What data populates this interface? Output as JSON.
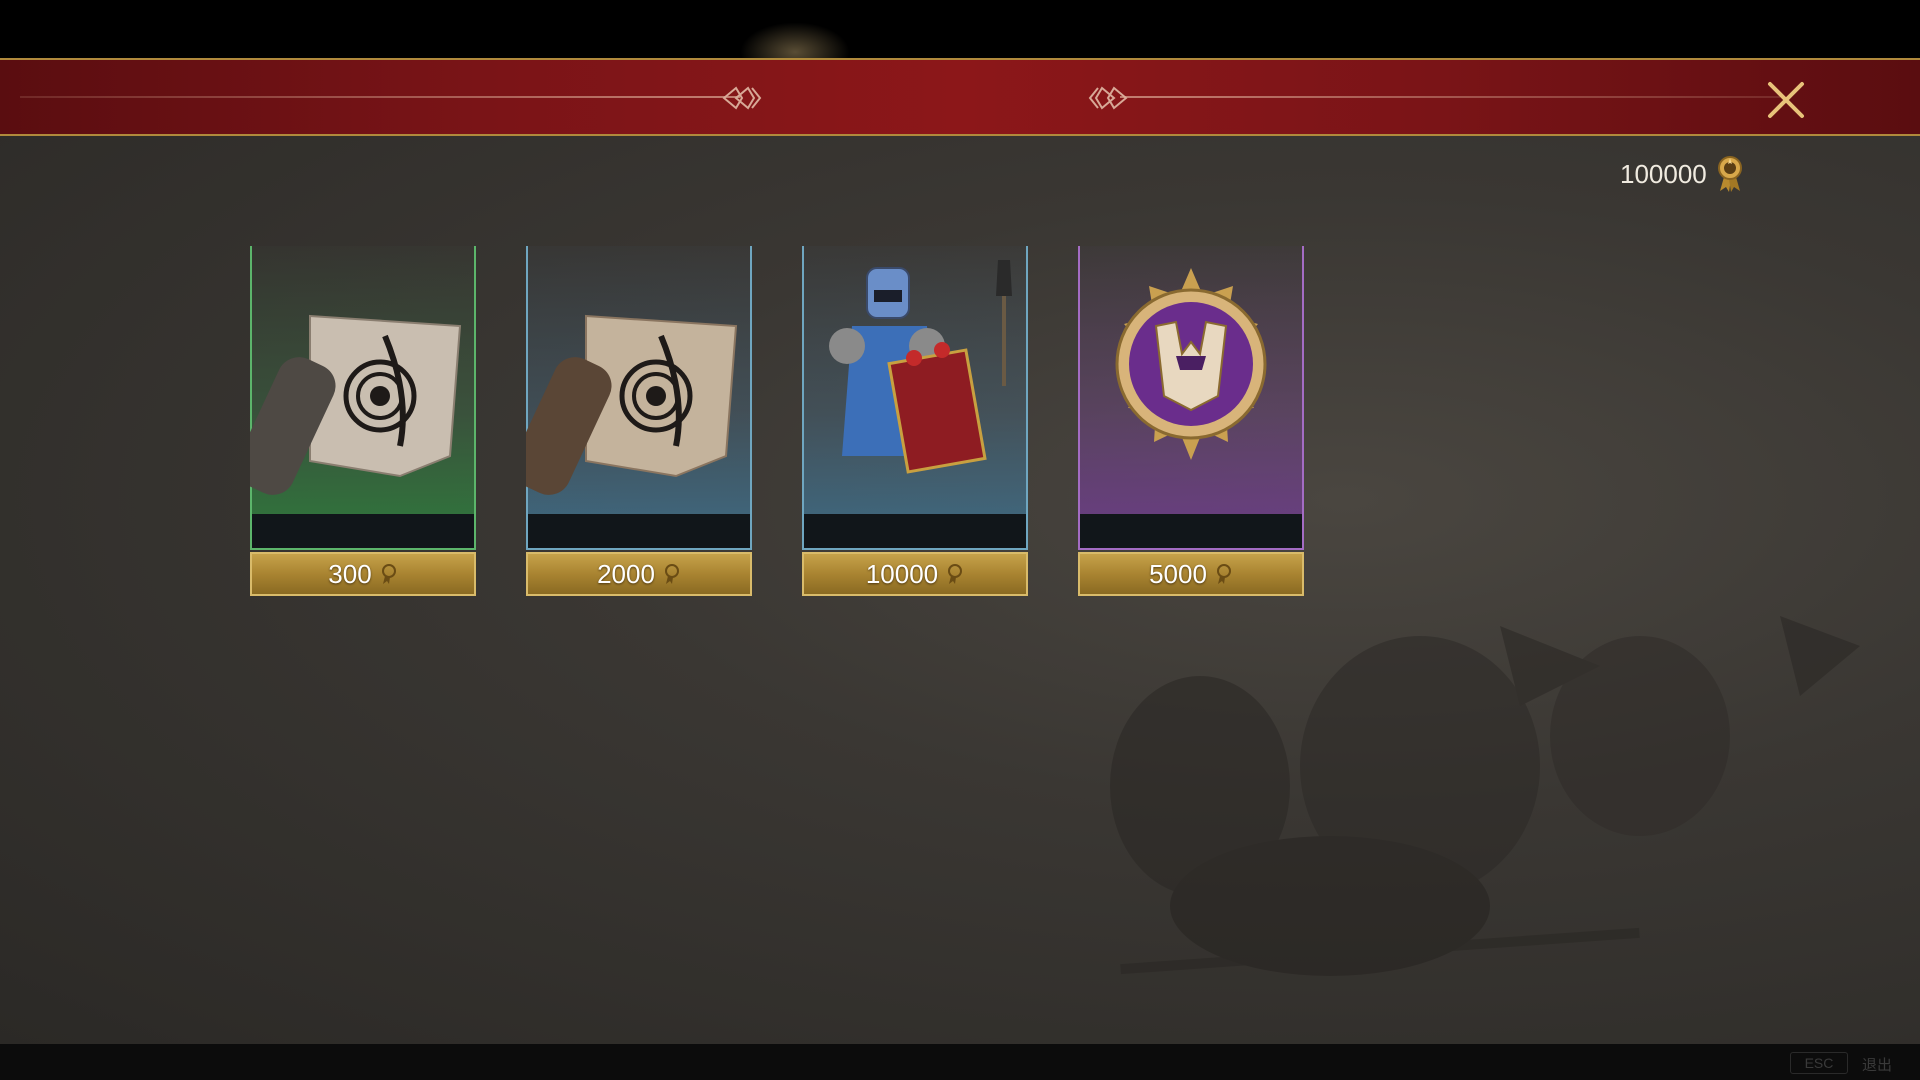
{
  "currency": {
    "amount": "100000",
    "icon": "medal-icon"
  },
  "shop": {
    "items": [
      {
        "price": "300",
        "rarity": "green",
        "icon": "scroll-icon",
        "name": ""
      },
      {
        "price": "2000",
        "rarity": "blue",
        "icon": "scroll-icon",
        "name": ""
      },
      {
        "price": "10000",
        "rarity": "blue",
        "icon": "knight-portrait-icon",
        "name": ""
      },
      {
        "price": "5000",
        "rarity": "purple",
        "icon": "helmet-emblem-icon",
        "name": ""
      }
    ]
  },
  "footer": {
    "esc_key": "ESC",
    "esc_label": "退出"
  },
  "colors": {
    "banner": "#8c1719",
    "gold": "#c6a24a",
    "rarity_green": "#5cb56b",
    "rarity_blue": "#6fa6c0",
    "rarity_purple": "#a46cc4"
  }
}
